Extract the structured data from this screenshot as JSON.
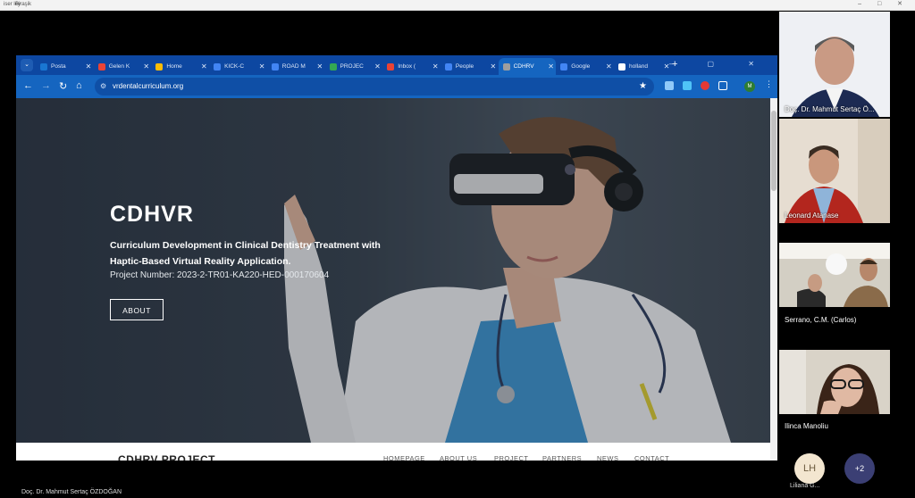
{
  "os_bar": {
    "item1": "iser ley",
    "item2": "Biraşik",
    "controls": "– □ ✕"
  },
  "browser": {
    "tabs": [
      {
        "label": "Posta",
        "icon": "outlook-icon",
        "color": "#1976d2"
      },
      {
        "label": "Gelen K",
        "icon": "gmail-icon",
        "color": "#ea4335"
      },
      {
        "label": "Home",
        "icon": "drive-icon",
        "color": "#fbbc04"
      },
      {
        "label": "KICK-C",
        "icon": "docs-icon",
        "color": "#4285f4"
      },
      {
        "label": "ROAD M",
        "icon": "docs-icon",
        "color": "#4285f4"
      },
      {
        "label": "PROJEC",
        "icon": "sheets-icon",
        "color": "#34a853"
      },
      {
        "label": "Inbox (",
        "icon": "gmail-icon",
        "color": "#ea4335"
      },
      {
        "label": "People",
        "icon": "people-icon",
        "color": "#4285f4"
      },
      {
        "label": "CDHRV",
        "icon": "vr-icon",
        "color": "#9e9e9e",
        "active": true
      },
      {
        "label": "Google",
        "icon": "gsite-icon",
        "color": "#4285f4"
      },
      {
        "label": "holland",
        "icon": "google-icon",
        "color": "#ffffff"
      }
    ],
    "tab_close": "✕",
    "new_tab": "+",
    "url": "vrdentalcurriculum.org",
    "profile_initial": "M"
  },
  "hero": {
    "title": "CDHVR",
    "subtitle": "Curriculum Development in Clinical Dentistry Treatment with Haptic-Based Virtual Reality Application.",
    "project_number": "Project Number: 2023-2-TR01-KA220-HED-000170604",
    "button": "ABOUT"
  },
  "site_nav": {
    "brand": "CDHRV PROJECT",
    "links": [
      "HOMEPAGE",
      "ABOUT US",
      "PROJECT",
      "PARTNERS",
      "NEWS",
      "CONTACT"
    ]
  },
  "participants": [
    {
      "name": "Doç. Dr. Mahmut Sertaç Ö..."
    },
    {
      "name": "Leonard Atanase"
    },
    {
      "name": "Serrano, C.M. (Carlos)"
    },
    {
      "name": "Ilinca Manoliu"
    }
  ],
  "extra": {
    "initials": "LH",
    "name": "Liliana G...",
    "more": "+2"
  },
  "presenter_label": "Doç. Dr. Mahmut Sertaç ÖZDOĞAN"
}
